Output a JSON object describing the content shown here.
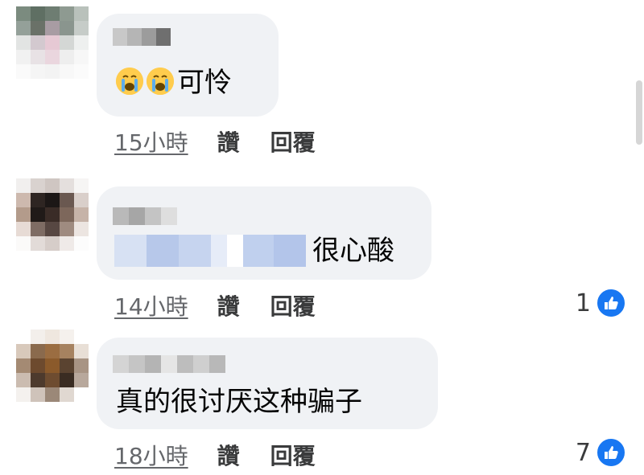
{
  "comments": [
    {
      "text": "可怜",
      "emoji_prefix": "crying-face-icon",
      "time": "15小時",
      "like": "讚",
      "reply": "回覆",
      "reactions": ""
    },
    {
      "text": "很心酸",
      "time": "14小時",
      "like": "讚",
      "reply": "回覆",
      "reactions": "1"
    },
    {
      "text": "真的很讨厌这种骗子",
      "time": "18小時",
      "like": "讚",
      "reply": "回覆",
      "reactions": "7"
    }
  ],
  "colors": {
    "bubble": "#f0f2f5",
    "like_blue": "#1877f2",
    "meta_gray": "#65676b",
    "tag_blur": "#c3d3ee"
  }
}
